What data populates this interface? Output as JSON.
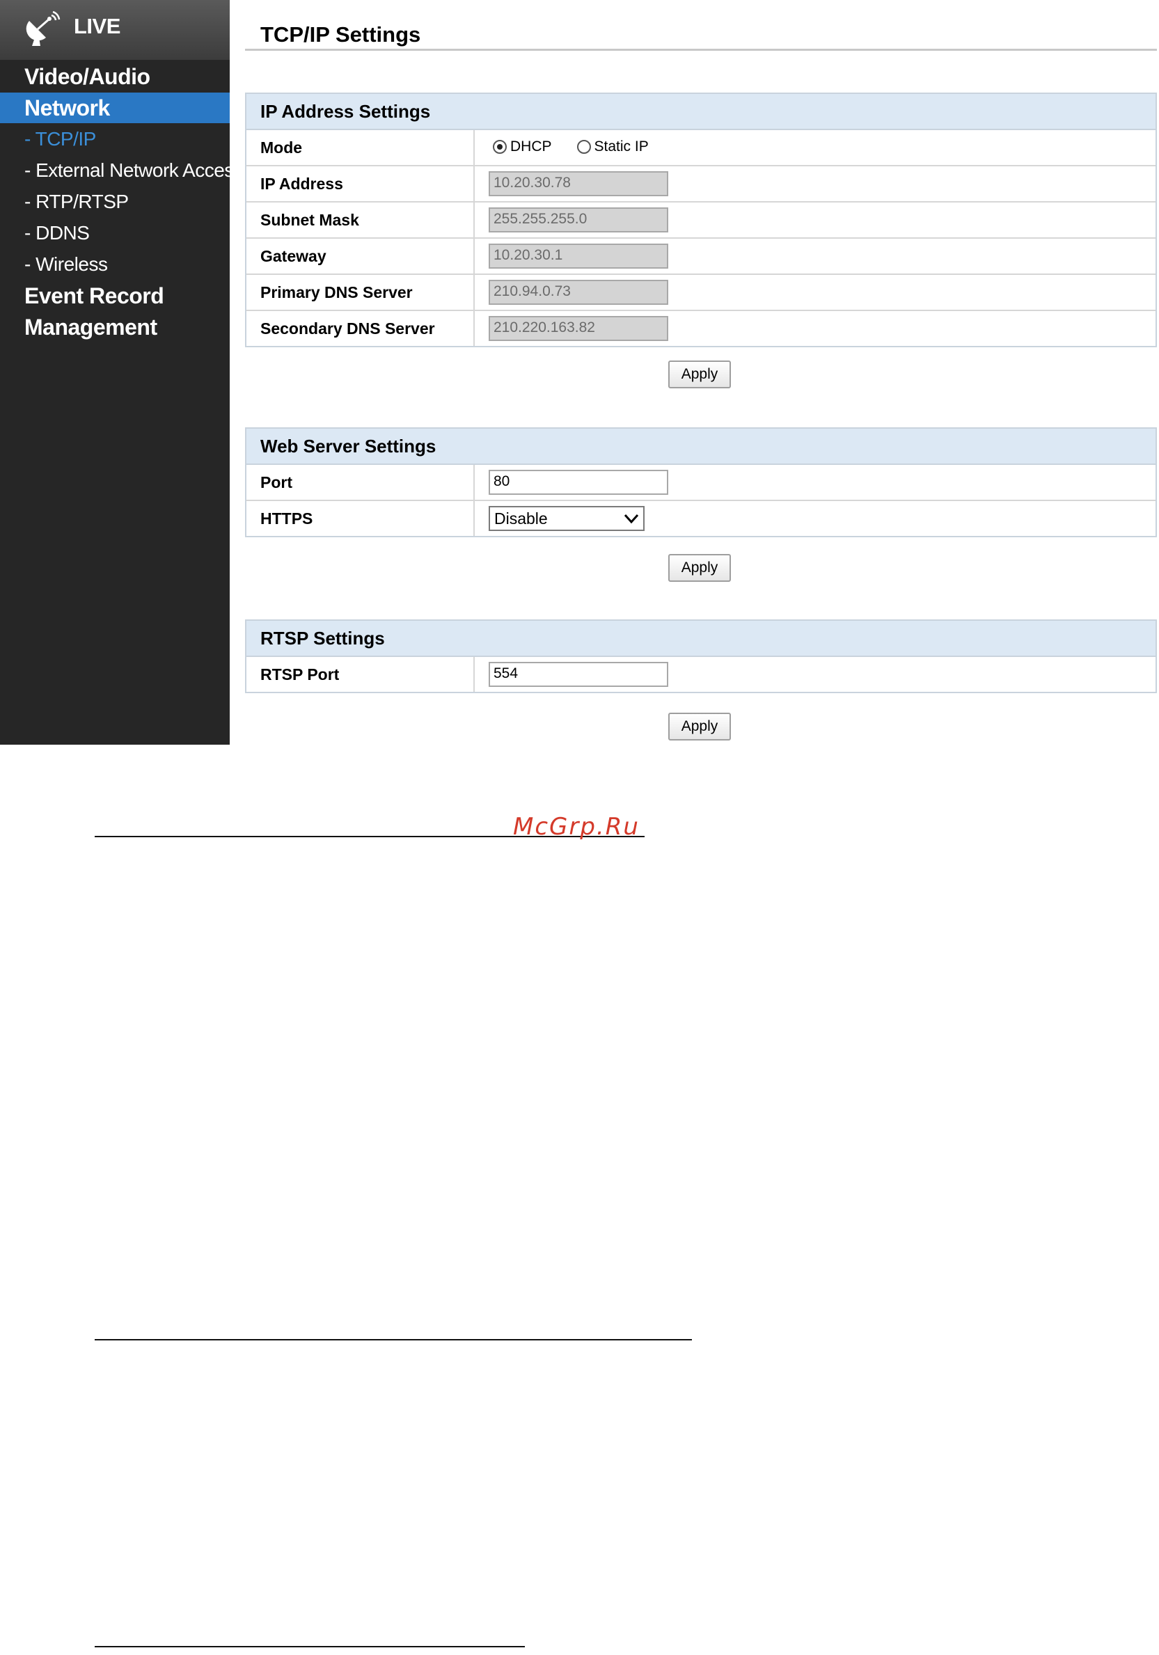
{
  "sidebar": {
    "live_label": "LIVE",
    "items": [
      {
        "label": "Video/Audio"
      },
      {
        "label": "Network"
      },
      {
        "label": "- TCP/IP"
      },
      {
        "label": "- External Network Access"
      },
      {
        "label": "- RTP/RTSP"
      },
      {
        "label": "- DDNS"
      },
      {
        "label": "- Wireless"
      },
      {
        "label": "Event Record"
      },
      {
        "label": "Management"
      }
    ],
    "colors": {
      "background": "#262626",
      "active": "#2a78c4",
      "current": "#3b8fd9"
    }
  },
  "page": {
    "title": "TCP/IP Settings"
  },
  "ip_settings": {
    "header": "IP Address Settings",
    "mode_label": "Mode",
    "mode_options": [
      "DHCP",
      "Static IP"
    ],
    "mode_selected": "DHCP",
    "fields": [
      {
        "label": "IP Address",
        "value": "10.20.30.78"
      },
      {
        "label": "Subnet Mask",
        "value": "255.255.255.0"
      },
      {
        "label": "Gateway",
        "value": "10.20.30.1"
      },
      {
        "label": "Primary DNS Server",
        "value": "210.94.0.73"
      },
      {
        "label": "Secondary DNS Server",
        "value": "210.220.163.82"
      }
    ],
    "apply_label": "Apply"
  },
  "web_server": {
    "header": "Web Server Settings",
    "port_label": "Port",
    "port_value": "80",
    "https_label": "HTTPS",
    "https_value": "Disable",
    "apply_label": "Apply"
  },
  "rtsp": {
    "header": "RTSP Settings",
    "port_label": "RTSP Port",
    "port_value": "554",
    "apply_label": "Apply"
  },
  "watermark": "McGrp.Ru"
}
